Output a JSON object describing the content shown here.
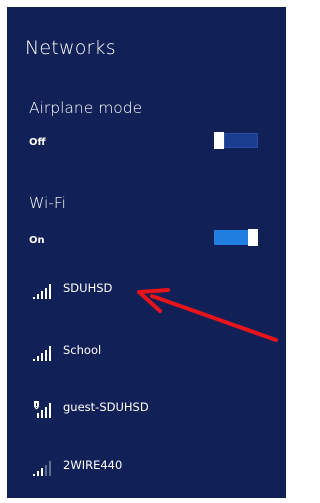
{
  "panel": {
    "title": "Networks",
    "background": "#112056"
  },
  "airplane": {
    "label": "Airplane mode",
    "state_text": "Off",
    "on": false
  },
  "wifi": {
    "label": "Wi-Fi",
    "state_text": "On",
    "on": true,
    "accent": "#1f7fe0"
  },
  "networks": [
    {
      "name": "SDUHSD",
      "secured": false,
      "signal_bars": 5,
      "icon": "wifi-signal-icon"
    },
    {
      "name": "School",
      "secured": false,
      "signal_bars": 5,
      "icon": "wifi-signal-icon"
    },
    {
      "name": "guest-SDUHSD",
      "secured": true,
      "signal_bars": 5,
      "icon": "wifi-signal-shield-icon"
    },
    {
      "name": "2WIRE440",
      "secured": false,
      "signal_bars": 3,
      "icon": "wifi-signal-icon"
    }
  ],
  "annotation": {
    "icon": "red-arrow-icon",
    "color": "#e8141b",
    "points_to": "SDUHSD"
  }
}
